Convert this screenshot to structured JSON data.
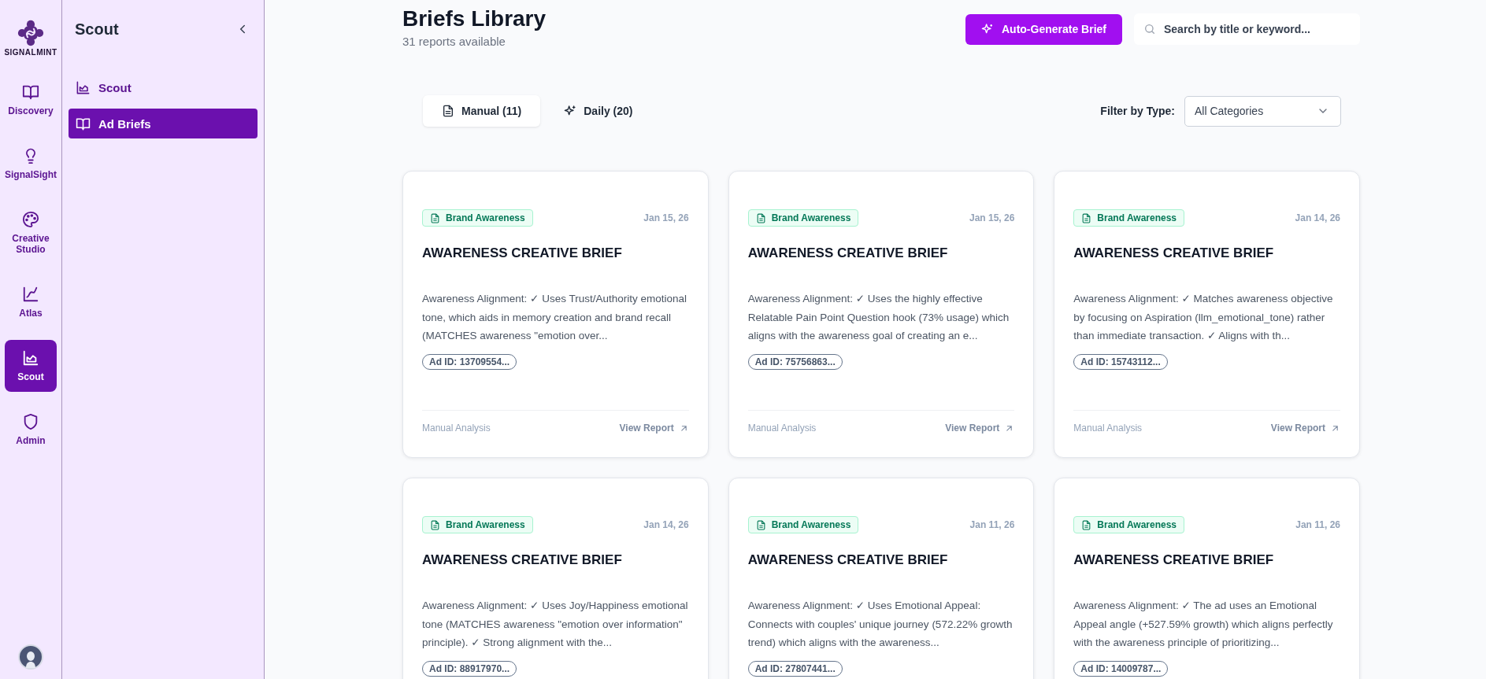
{
  "rail": {
    "logo": "SIGNALMINT",
    "items": [
      {
        "label": "Discovery",
        "selected": false
      },
      {
        "label": "SignalSight",
        "selected": false
      },
      {
        "label": "Creative Studio",
        "selected": false
      },
      {
        "label": "Atlas",
        "selected": false
      },
      {
        "label": "Scout",
        "selected": true
      },
      {
        "label": "Admin",
        "selected": false
      }
    ]
  },
  "sidebar": {
    "title": "Scout",
    "items": [
      {
        "label": "Scout",
        "selected": false
      },
      {
        "label": "Ad Briefs",
        "selected": true
      }
    ]
  },
  "header": {
    "title": "Briefs Library",
    "subtitle": "31 reports available",
    "button": "Auto-Generate Brief",
    "search": {
      "placeholder": "Search by title or keyword..."
    }
  },
  "tabs": [
    {
      "label": "Manual (11)",
      "selected": true
    },
    {
      "label": "Daily (20)",
      "selected": false
    }
  ],
  "filter": {
    "label": "Filter by Type:",
    "value": "All Categories"
  },
  "cards": [
    {
      "badge": "Brand Awareness",
      "date": "Jan 15, 26",
      "title": "AWARENESS CREATIVE BRIEF",
      "description": "Awareness Alignment: ✓ Uses Trust/Authority emotional tone, which aids in memory creation and brand recall (MATCHES awareness \"emotion over...",
      "ad_id": "Ad ID: 13709554...",
      "footer": {
        "source": "Manual Analysis",
        "link": "View Report"
      }
    },
    {
      "badge": "Brand Awareness",
      "date": "Jan 15, 26",
      "title": "AWARENESS CREATIVE BRIEF",
      "description": "Awareness Alignment: ✓ Uses the highly effective Relatable Pain Point Question hook (73% usage) which aligns with the awareness goal of creating an e...",
      "ad_id": "Ad ID: 75756863...",
      "footer": {
        "source": "Manual Analysis",
        "link": "View Report"
      }
    },
    {
      "badge": "Brand Awareness",
      "date": "Jan 14, 26",
      "title": "AWARENESS CREATIVE BRIEF",
      "description": "Awareness Alignment: ✓ Matches awareness objective by focusing on Aspiration (llm_emotional_tone) rather than immediate transaction. ✓ Aligns with th...",
      "ad_id": "Ad ID: 15743112...",
      "footer": {
        "source": "Manual Analysis",
        "link": "View Report"
      }
    },
    {
      "badge": "Brand Awareness",
      "date": "Jan 14, 26",
      "title": "AWARENESS CREATIVE BRIEF",
      "description": "Awareness Alignment: ✓ Uses Joy/Happiness emotional tone (MATCHES awareness \"emotion over information\" principle). ✓ Strong alignment with the...",
      "ad_id": "Ad ID: 88917970..."
    },
    {
      "badge": "Brand Awareness",
      "date": "Jan 11, 26",
      "title": "AWARENESS CREATIVE BRIEF",
      "description": "Awareness Alignment: ✓ Uses Emotional Appeal: Connects with couples' unique journey (572.22% growth trend) which aligns with the awareness...",
      "ad_id": "Ad ID: 27807441..."
    },
    {
      "badge": "Brand Awareness",
      "date": "Jan 11, 26",
      "title": "AWARENESS CREATIVE BRIEF",
      "description": "Awareness Alignment: ✓ The ad uses an Emotional Appeal angle (+527.59% growth) which aligns perfectly with the awareness principle of prioritizing...",
      "ad_id": "Ad ID: 14009787..."
    }
  ]
}
